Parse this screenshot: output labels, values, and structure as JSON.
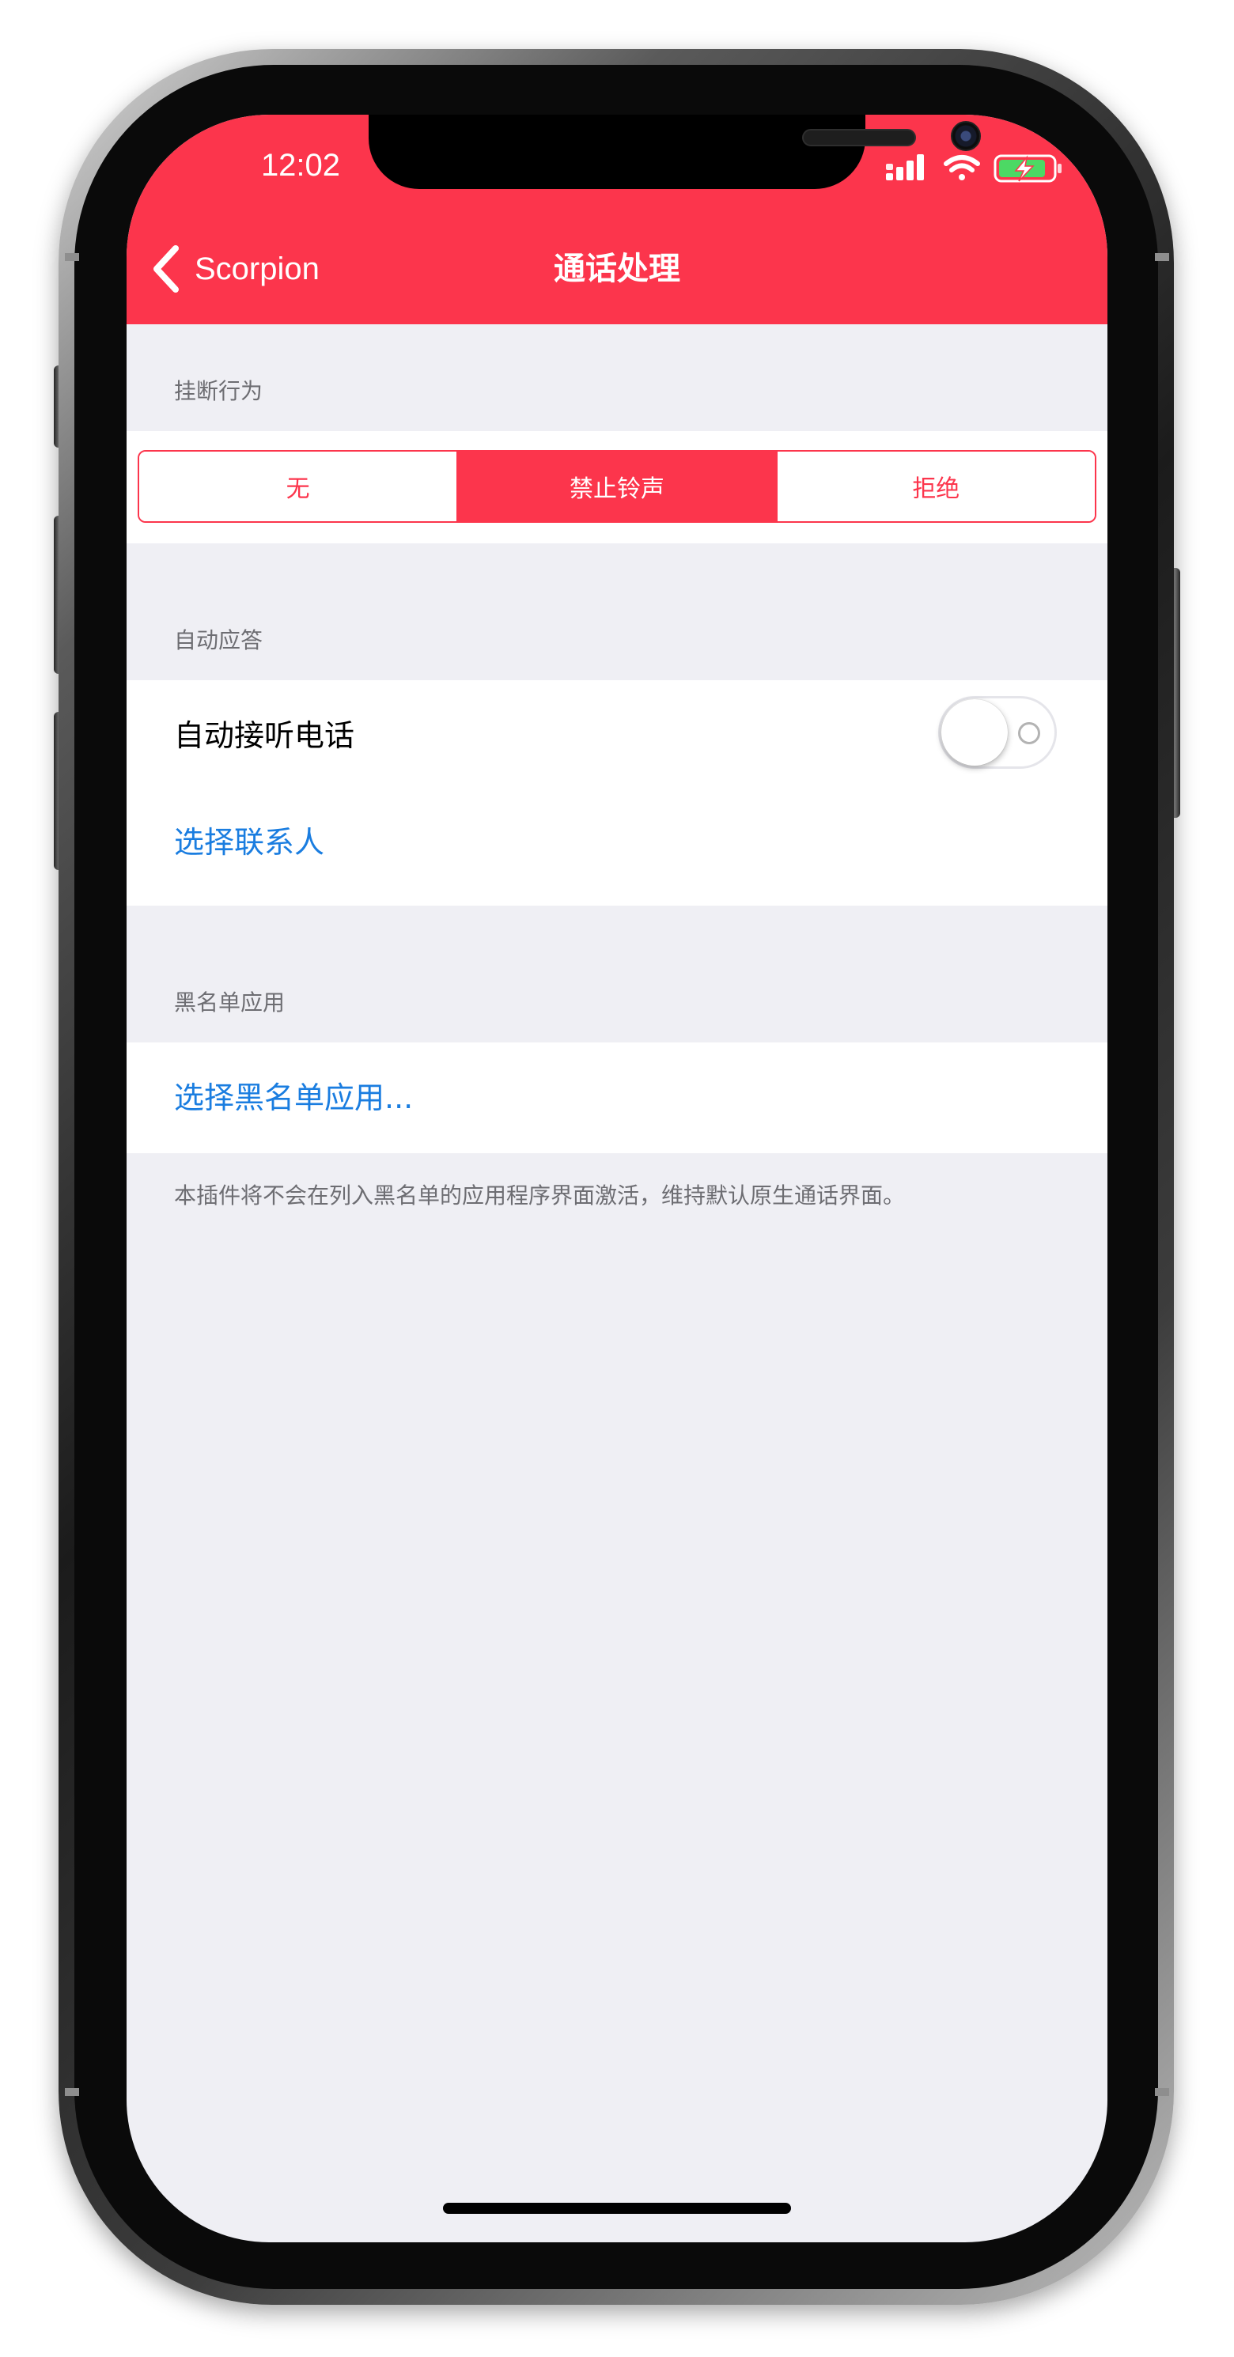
{
  "status_bar": {
    "time": "12:02",
    "icons": [
      "cellular-signal-icon",
      "wifi-icon",
      "battery-charging-icon"
    ]
  },
  "nav": {
    "back_label": "Scorpion",
    "title": "通话处理",
    "background_color": "#fc354c"
  },
  "hangup_section": {
    "header": "挂断行为",
    "options": [
      "无",
      "禁止铃声",
      "拒绝"
    ],
    "selected": "禁止铃声"
  },
  "auto_answer_section": {
    "header": "自动应答",
    "toggle_label": "自动接听电话",
    "toggle_on": false,
    "select_contacts": "选择联系人"
  },
  "blacklist_section": {
    "header": "黑名单应用",
    "select_apps": "选择黑名单应用...",
    "footer": "本插件将不会在列入黑名单的应用程序界面激活，维持默认原生通话界面。"
  },
  "colors": {
    "accent": "#fc354c",
    "link": "#1a7de0",
    "group_background": "#efeff4"
  }
}
